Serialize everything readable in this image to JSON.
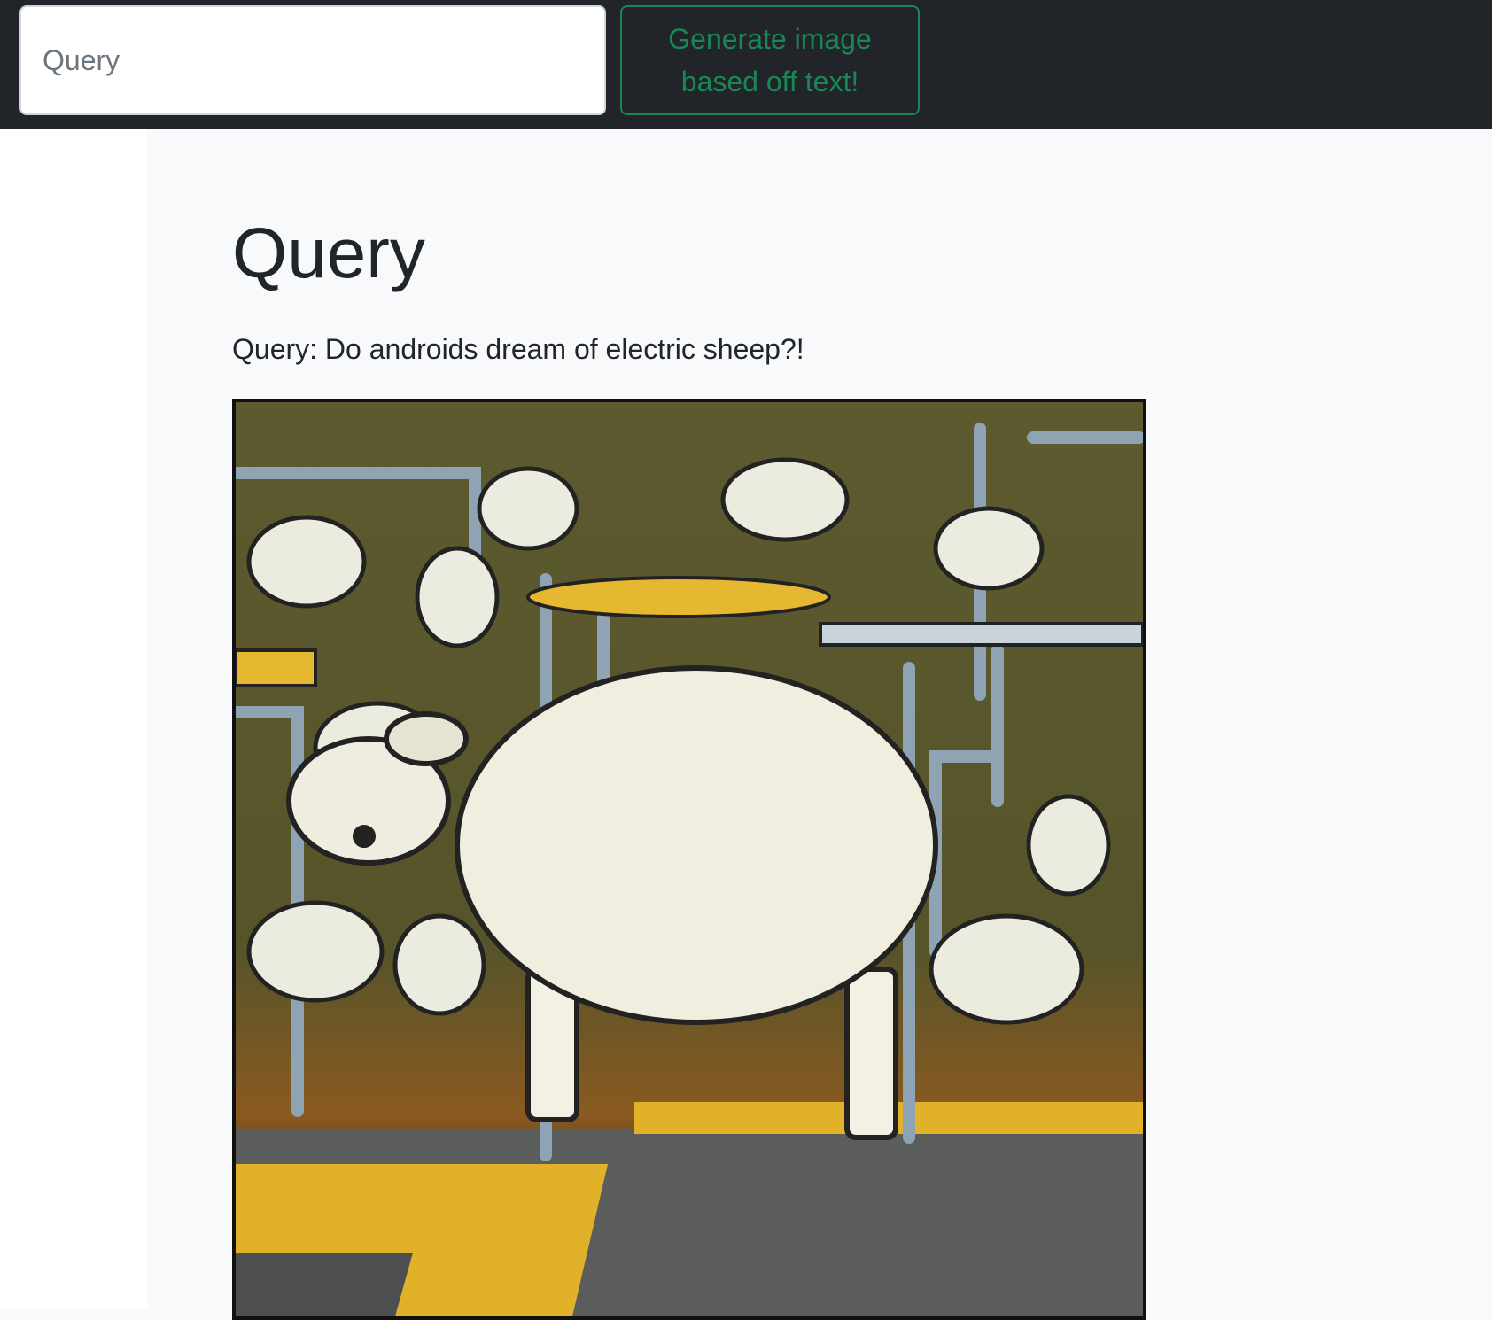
{
  "navbar": {
    "search": {
      "placeholder": "Query",
      "value": ""
    },
    "generate_label": "Generate image based off text!",
    "accent_color": "#198754"
  },
  "main": {
    "title": "Query",
    "query_text": "Query: Do androids dream of electric sheep?!",
    "image": {
      "description_icon": "generated-sheep-image"
    }
  }
}
